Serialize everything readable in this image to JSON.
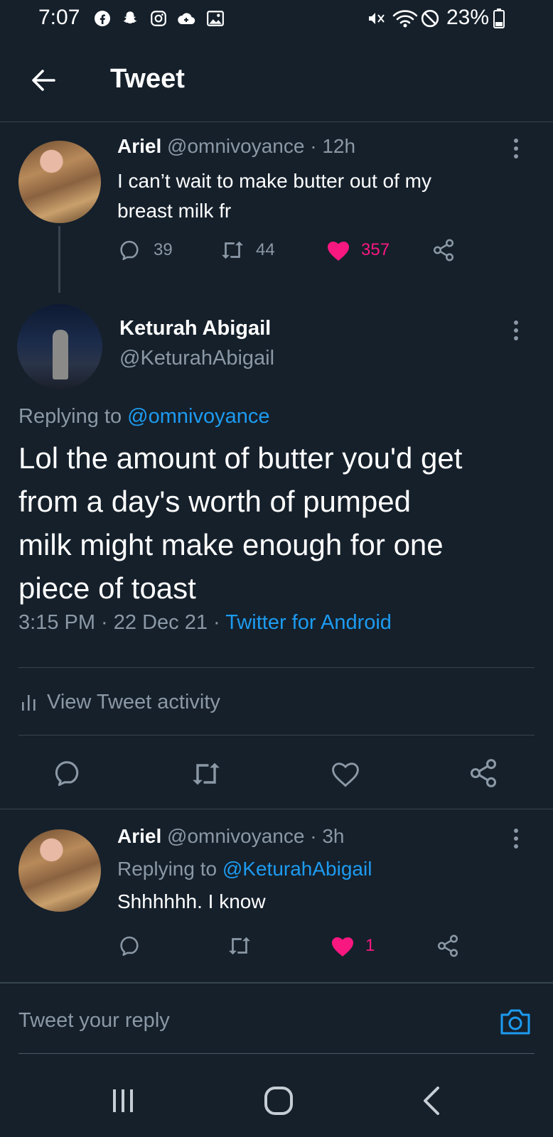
{
  "status_bar": {
    "time": "7:07",
    "battery": "23%"
  },
  "header": {
    "title": "Tweet"
  },
  "parent_tweet": {
    "name": "Ariel",
    "meta": "@omnivoyance · 12h",
    "text_line1": "I can’t wait to make butter out of my",
    "text_line2": "breast milk fr",
    "replies": "39",
    "retweets": "44",
    "likes": "357"
  },
  "main_tweet": {
    "name": "Keturah Abigail",
    "handle": "@KeturahAbigail",
    "replying_prefix": "Replying to ",
    "replying_to": "@omnivoyance",
    "text_line1": "Lol the amount of butter you'd get",
    "text_line2": "from a day's worth of pumped",
    "text_line3": "milk might make enough for one",
    "text_line4": "piece of toast",
    "timestamp": "3:15 PM · 22 Dec 21 · ",
    "source": "Twitter for Android",
    "activity_label": "View Tweet activity"
  },
  "reply_tweet": {
    "name": "Ariel",
    "meta": "@omnivoyance · 3h",
    "replying_prefix": "Replying to ",
    "replying_to": "@KeturahAbigail",
    "text": "Shhhhhh. I know",
    "likes": "1"
  },
  "composer": {
    "placeholder": "Tweet your reply"
  },
  "colors": {
    "background": "#15202b",
    "accent": "#1d9bf0",
    "like": "#f91880",
    "muted": "#8b98a5"
  },
  "icons": [
    "facebook-icon",
    "snapchat-icon",
    "instagram-icon",
    "cloud-icon",
    "gallery-icon",
    "mute-icon",
    "wifi-icon",
    "dnd-icon",
    "battery-icon",
    "back-arrow-icon",
    "more-icon",
    "reply-icon",
    "retweet-icon",
    "heart-icon",
    "share-icon",
    "bar-chart-icon",
    "camera-icon",
    "recents-icon",
    "home-icon",
    "nav-back-icon"
  ]
}
